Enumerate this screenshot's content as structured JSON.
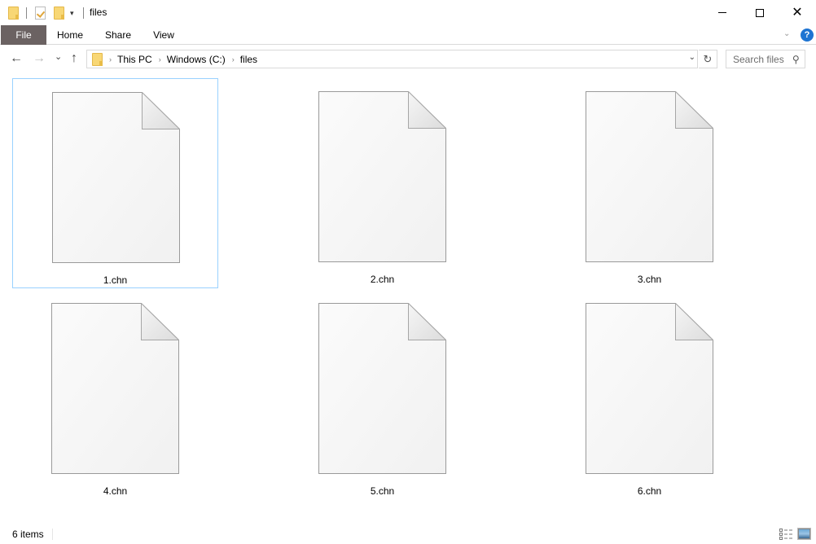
{
  "window": {
    "title": "files",
    "controls": {
      "minimize": "minimize",
      "maximize": "maximize",
      "close": "close"
    }
  },
  "quick_access": {
    "icons": [
      "folder-icon",
      "properties-icon",
      "new-folder-icon",
      "customize-dropdown-icon"
    ]
  },
  "ribbon": {
    "tabs": [
      {
        "label": "File",
        "active": true
      },
      {
        "label": "Home"
      },
      {
        "label": "Share"
      },
      {
        "label": "View"
      }
    ],
    "help_glyph": "?"
  },
  "navigation": {
    "back_glyph": "←",
    "forward_glyph": "→",
    "recent_glyph": "⌄",
    "up_glyph": "↑",
    "breadcrumb": [
      "This PC",
      "Windows (C:)",
      "files"
    ],
    "breadcrumb_sep": "›",
    "dropdown_glyph": "⌄",
    "refresh_glyph": "↻",
    "search_placeholder": "Search files",
    "search_glyph": "⚲"
  },
  "files": [
    {
      "name": "1.chn",
      "selected": true
    },
    {
      "name": "2.chn"
    },
    {
      "name": "3.chn"
    },
    {
      "name": "4.chn"
    },
    {
      "name": "5.chn"
    },
    {
      "name": "6.chn"
    }
  ],
  "status": {
    "item_count": "6 items",
    "view_modes": [
      "details",
      "large-icons"
    ],
    "active_view": "large-icons"
  },
  "colors": {
    "file_tab_bg": "#6b6262",
    "selection_border": "#99d1ff",
    "help_blue": "#1d74d2"
  }
}
